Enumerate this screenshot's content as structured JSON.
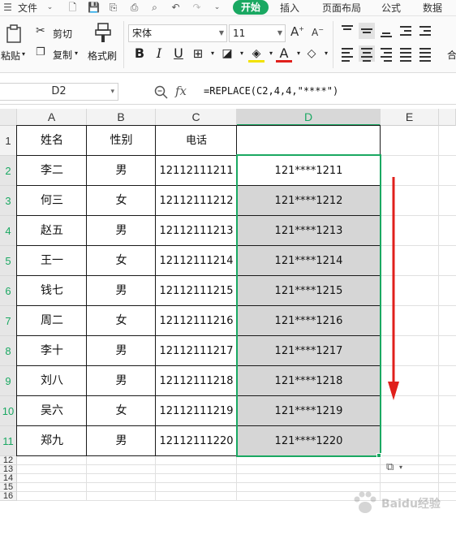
{
  "menubar": {
    "file": "文件",
    "tabs": [
      "开始",
      "插入",
      "页面布局",
      "公式",
      "数据"
    ]
  },
  "ribbon": {
    "paste": "粘贴",
    "cut": "剪切",
    "copy": "复制",
    "format_painter": "格式刷",
    "font_name": "宋体",
    "font_size": "11",
    "merge_partial": "合"
  },
  "formula_bar": {
    "name_box": "D2",
    "fx": "fx",
    "formula": "=REPLACE(C2,4,4,\"****\")"
  },
  "columns": [
    "A",
    "B",
    "C",
    "D",
    "E"
  ],
  "rows": [
    "1",
    "2",
    "3",
    "4",
    "5",
    "6",
    "7",
    "8",
    "9",
    "10",
    "11",
    "12",
    "13",
    "14",
    "15",
    "16"
  ],
  "table": {
    "headers": [
      "姓名",
      "性别",
      "电话",
      ""
    ],
    "rows": [
      [
        "李二",
        "男",
        "12112111211",
        "121****1211"
      ],
      [
        "何三",
        "女",
        "12112111212",
        "121****1212"
      ],
      [
        "赵五",
        "男",
        "12112111213",
        "121****1213"
      ],
      [
        "王一",
        "女",
        "12112111214",
        "121****1214"
      ],
      [
        "钱七",
        "男",
        "12112111215",
        "121****1215"
      ],
      [
        "周二",
        "女",
        "12112111216",
        "121****1216"
      ],
      [
        "李十",
        "男",
        "12112111217",
        "121****1217"
      ],
      [
        "刘八",
        "男",
        "12112111218",
        "121****1218"
      ],
      [
        "吴六",
        "女",
        "12112111219",
        "121****1219"
      ],
      [
        "郑九",
        "男",
        "12112111220",
        "121****1220"
      ]
    ]
  },
  "colors": {
    "accent": "#1aa862",
    "selection_fill": "#d6d6d6",
    "arrow": "#e0201c"
  },
  "watermark": "Baidu经验"
}
